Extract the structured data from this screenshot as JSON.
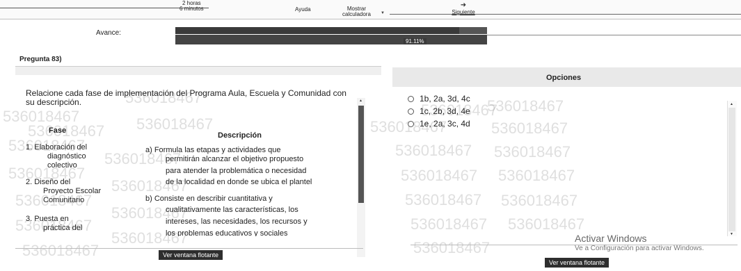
{
  "toolbar": {
    "timer_hours": "2 horas",
    "timer_minutes": "6 minutos",
    "help_label": "Ayuda",
    "calc_line1": "Mostrar",
    "calc_line2": "calculadora",
    "next_icon": "arrow-right-icon",
    "next_label": "Siguiente"
  },
  "progress": {
    "label": "Avance:",
    "percent": 91.11,
    "percent_text": "91.11%"
  },
  "question": {
    "header": "Pregunta 83)",
    "text": "Relacione cada fase de implementación del Programa Aula, Escuela y Comunidad con su descripción.",
    "table": {
      "col_phase": "Fase",
      "col_desc": "Descripción",
      "phases": [
        "1. Elaboración del",
        "diagnóstico",
        "colectivo",
        "2. Diseño del",
        "Proyecto Escolar",
        "Comunitario",
        "3. Puesta en",
        "práctica del"
      ],
      "descriptions": [
        "a) Formula las etapas y actividades que",
        "permitirán alcanzar el objetivo propuesto",
        "para atender la problemática o necesidad",
        "de la localidad en donde se ubica el plantel",
        "b) Consiste en describir cuantitativa y",
        "cualitativamente las características, los",
        "intereses, las necesidades, los recursos y",
        "los problemas educativos y sociales"
      ]
    }
  },
  "options": {
    "header": "Opciones",
    "items": [
      "1b, 2a, 3d, 4c",
      "1c, 2b, 3d, 4e",
      "1e, 2a, 3c, 4d"
    ]
  },
  "watermark": "536018467",
  "floating": {
    "left_label": "Ver ventana flotante",
    "right_label": "Ver ventana flotante"
  },
  "windows_activation": {
    "title": "Activar Windows",
    "subtitle": "Ve a Configuración para activar Windows."
  }
}
